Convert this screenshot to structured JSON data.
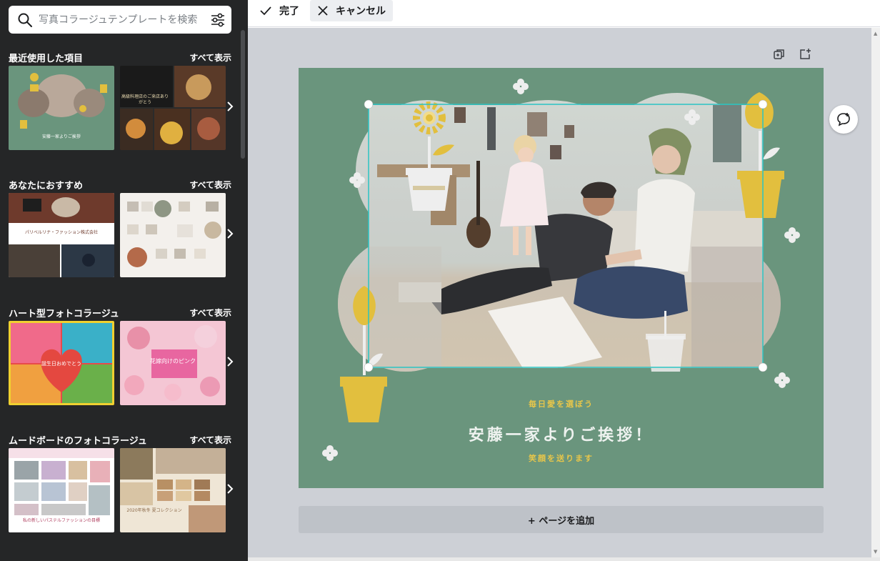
{
  "search": {
    "placeholder": "写真コラージュテンプレートを検索"
  },
  "sections": [
    {
      "title": "最近使用した項目",
      "see_all": "すべて表示",
      "thumbs": [
        {
          "caption": "安藤一家よりご挨拶",
          "bg": "#6a957d"
        },
        {
          "caption": "高級料理店のご来店ありがとう",
          "bg": "#2b2b2b"
        }
      ]
    },
    {
      "title": "あなたにおすすめ",
      "see_all": "すべて表示",
      "thumbs": [
        {
          "caption": "パリベルリナ・ファッション株式会社",
          "bg": "#ffffff"
        },
        {
          "caption": "",
          "bg": "#f3f0ec"
        }
      ]
    },
    {
      "title": "ハート型フォトコラージュ",
      "see_all": "すべて表示",
      "thumbs": [
        {
          "caption": "誕生日おめでとう",
          "bg": "#e8404a"
        },
        {
          "caption": "花嫁向けのピンク",
          "bg": "#f4c6d4"
        }
      ]
    },
    {
      "title": "ムードボードのフォトコラージュ",
      "see_all": "すべて表示",
      "thumbs": [
        {
          "caption": "私の新しいパステルファッションの目標",
          "bg": "#f6e9ee"
        },
        {
          "caption": "2020年秋冬 夏コレクション",
          "bg": "#efe6d6"
        }
      ]
    }
  ],
  "toolbar": {
    "done_label": "完了",
    "cancel_label": "キャンセル"
  },
  "design": {
    "top_text": "毎日愛を選ぼう",
    "main_text": "安藤一家よりご挨拶！",
    "sub_text": "笑顔を送ります",
    "bg_color": "#6a957d",
    "accent_color": "#e2bf3e",
    "selection_color": "#2bc4c4"
  },
  "add_page_label": "+ ページを追加",
  "colors": {
    "sidebar_bg": "#252627",
    "canvas_bg": "#cdd0d6",
    "page_green": "#6a957d",
    "flower_yellow": "#e2bf3e"
  }
}
